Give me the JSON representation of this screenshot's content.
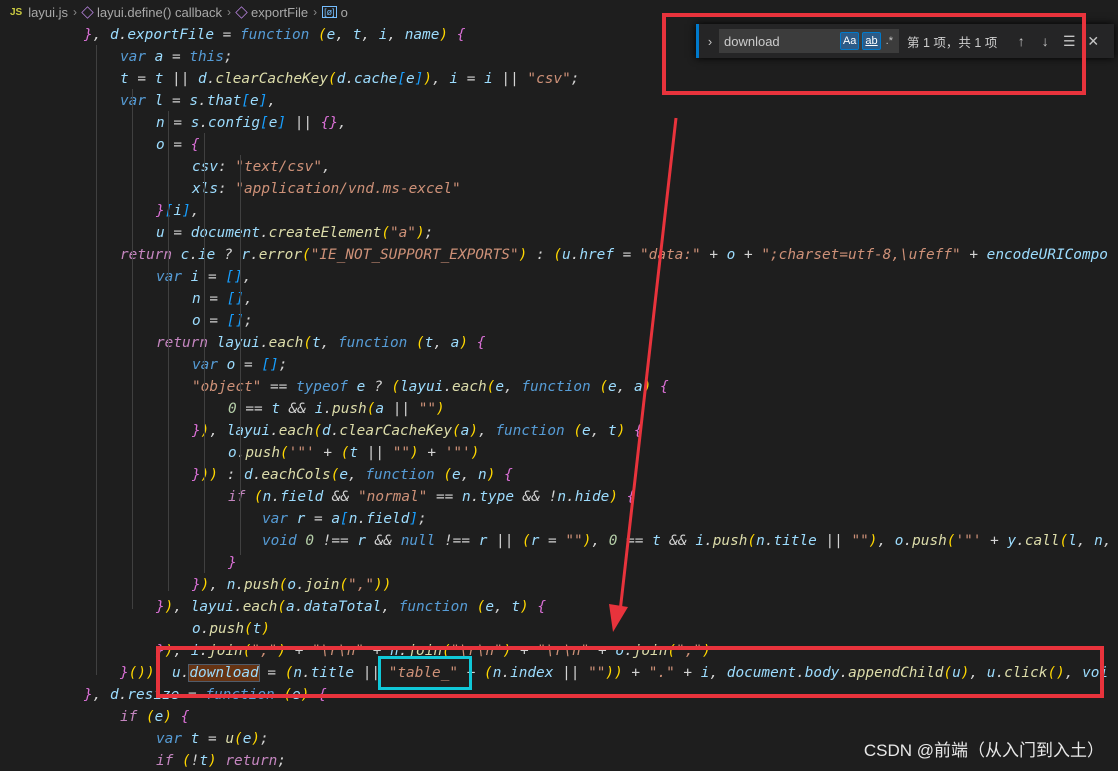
{
  "breadcrumb": {
    "js_badge": "JS",
    "items": [
      "layui.js",
      "layui.define() callback",
      "exportFile",
      "o"
    ]
  },
  "find_widget": {
    "query": "download",
    "match_case_label": "Aa",
    "whole_word_label": "ab",
    "regex_label": ".*",
    "result_count": "第 1 项，共 1 项",
    "toggle_icon": "chevron-right-icon",
    "prev_icon": "arrow-up-icon",
    "next_icon": "arrow-down-icon",
    "selection_icon": "list-icon",
    "close_icon": "close-icon"
  },
  "code_lines": [
    "}, d.exportFile = function (e, t, i, name) {",
    "var a = this;",
    "t = t || d.clearCacheKey(d.cache[e]), i = i || \"csv\";",
    "var l = s.that[e],",
    "n = s.config[e] || {},",
    "o = {",
    "csv: \"text/csv\",",
    "xls: \"application/vnd.ms-excel\"",
    "}[i],",
    "u = document.createElement(\"a\");",
    "return c.ie ? r.error(\"IE_NOT_SUPPORT_EXPORTS\") : (u.href = \"data:\" + o + \";charset=utf-8,\\ufeff\" + encodeURICompo",
    "var i = [],",
    "n = [],",
    "o = [];",
    "return layui.each(t, function (t, a) {",
    "var o = [];",
    "\"object\" == typeof e ? (layui.each(e, function (e, a) {",
    "0 == t && i.push(a || \"\")",
    "}), layui.each(d.clearCacheKey(a), function (e, t) {",
    "o.push('\"' + (t || \"\") + '\"')",
    "})) : d.eachCols(e, function (e, n) {",
    "if (n.field && \"normal\" == n.type && !n.hide) {",
    "var r = a[n.field];",
    "void 0 !== r && null !== r || (r = \"\"), 0 == t && i.push(n.title || \"\"), o.push('\"' + y.call(l, n,",
    "}",
    "}), n.push(o.join(\",\"))",
    "}), layui.each(a.dataTotal, function (e, t) {",
    "o.push(t)",
    "}), i.join(\",\") + \"\\r\\n\" + n.join(\"\\r\\n\") + \"\\r\\n\" + o.join(\",\")",
    "}()), u.download = (n.title || \"table_\" + (n.index || \"\")) + \".\" + i, document.body.appendChild(u), u.click(), voi",
    "}, d.resize = function (e) {",
    "if (e) {",
    "var t = u(e);",
    "if (!t) return;"
  ],
  "watermark": "CSDN @前端（从入门到入土）",
  "colors": {
    "annotation_red": "#e8333c",
    "annotation_cyan": "#10c8d8",
    "editor_bg": "#1e1e1e"
  }
}
